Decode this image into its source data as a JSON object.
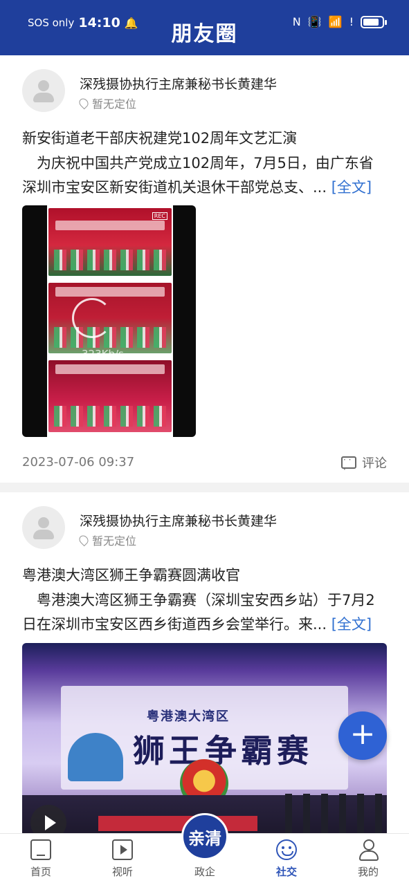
{
  "status_bar": {
    "carrier": "SOS only",
    "time": "14:10",
    "battery_level": 0.85
  },
  "header": {
    "title": "朋友圈"
  },
  "posts": [
    {
      "author": "深残摄协执行主席兼秘书长黄建华",
      "location": "暂无定位",
      "title": "新安街道老干部庆祝建党102周年文艺汇演",
      "excerpt": "为庆祝中国共产党成立102周年，7月5日，由广东省深圳市宝安区新安街道机关退休干部党总支、...",
      "more_label": "[全文]",
      "media_overlay_text": "323Kb/s",
      "timestamp": "2023-07-06 09:37",
      "comment_label": "评论"
    },
    {
      "author": "深残摄协执行主席兼秘书长黄建华",
      "location": "暂无定位",
      "title": "粤港澳大湾区狮王争霸赛圆满收官",
      "excerpt": "粤港澳大湾区狮王争霸赛（深圳宝安西乡站）于7月2日在深圳市宝安区西乡街道西乡会堂举行。来...",
      "more_label": "[全文]",
      "media_sub_title": "粤港澳大湾区",
      "media_big_title": "狮王争霸赛"
    }
  ],
  "fab": {
    "label": "+"
  },
  "tabbar": {
    "center_badge": "亲清",
    "tabs": [
      {
        "label": "首页",
        "icon": "home-icon"
      },
      {
        "label": "视听",
        "icon": "video-icon"
      },
      {
        "label": "政企",
        "icon": ""
      },
      {
        "label": "社交",
        "icon": "chat-icon",
        "active": true
      },
      {
        "label": "我的",
        "icon": "profile-icon"
      }
    ]
  },
  "colors": {
    "header_bg": "#1f3f9c",
    "accent": "#2f62d4",
    "link": "#2f6fd0",
    "active_tab": "#2f55b8"
  }
}
